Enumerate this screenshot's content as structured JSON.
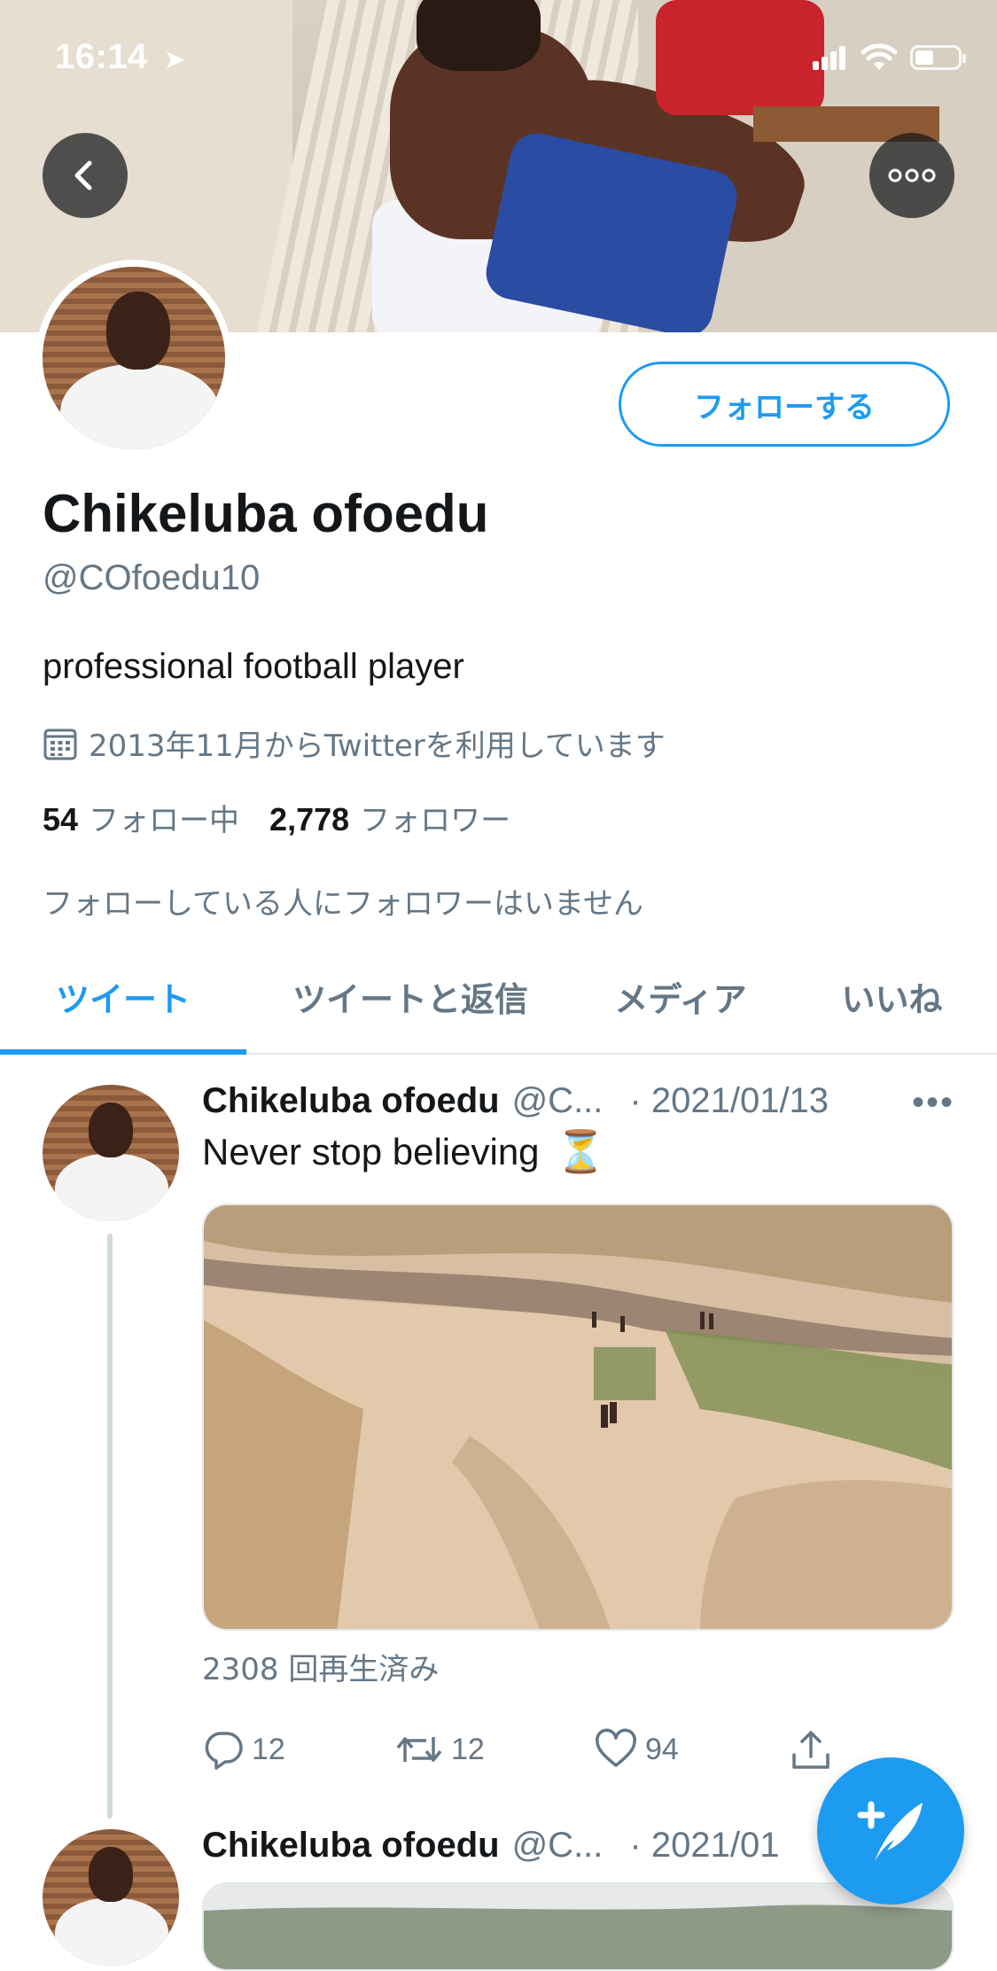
{
  "status_bar": {
    "time": "16:14"
  },
  "profile": {
    "name": "Chikeluba ofoedu",
    "handle": "@COfoedu10",
    "bio": "professional football player",
    "joined": "2013年11月からTwitterを利用しています",
    "following_count": "54",
    "following_label": "フォロー中",
    "followers_count": "2,778",
    "followers_label": "フォロワー",
    "followers_you_know": "フォローしている人にフォロワーはいません",
    "follow_button": "フォローする"
  },
  "tabs": [
    {
      "label": "ツイート",
      "active": true
    },
    {
      "label": "ツイートと返信",
      "active": false
    },
    {
      "label": "メディア",
      "active": false
    },
    {
      "label": "いいね",
      "active": false
    }
  ],
  "tweets": [
    {
      "name": "Chikeluba ofoedu",
      "handle": "@C...",
      "date": "· 2021/01/13",
      "more": "•••",
      "text": "Never stop believing",
      "emoji": "⏳",
      "views": "2308 回再生済み",
      "replies": "12",
      "retweets": "12",
      "likes": "94"
    },
    {
      "name": "Chikeluba ofoedu",
      "handle": "@C...",
      "date": "· 2021/01"
    }
  ],
  "icons": {
    "back": "chevron-left-icon",
    "more": "more-dots-icon",
    "calendar": "calendar-icon",
    "reply": "reply-icon",
    "retweet": "retweet-icon",
    "like": "heart-icon",
    "share": "share-icon",
    "compose": "compose-tweet-icon"
  },
  "colors": {
    "accent": "#1d9bf0",
    "secondary_text": "#657786",
    "primary_text": "#14171a"
  }
}
